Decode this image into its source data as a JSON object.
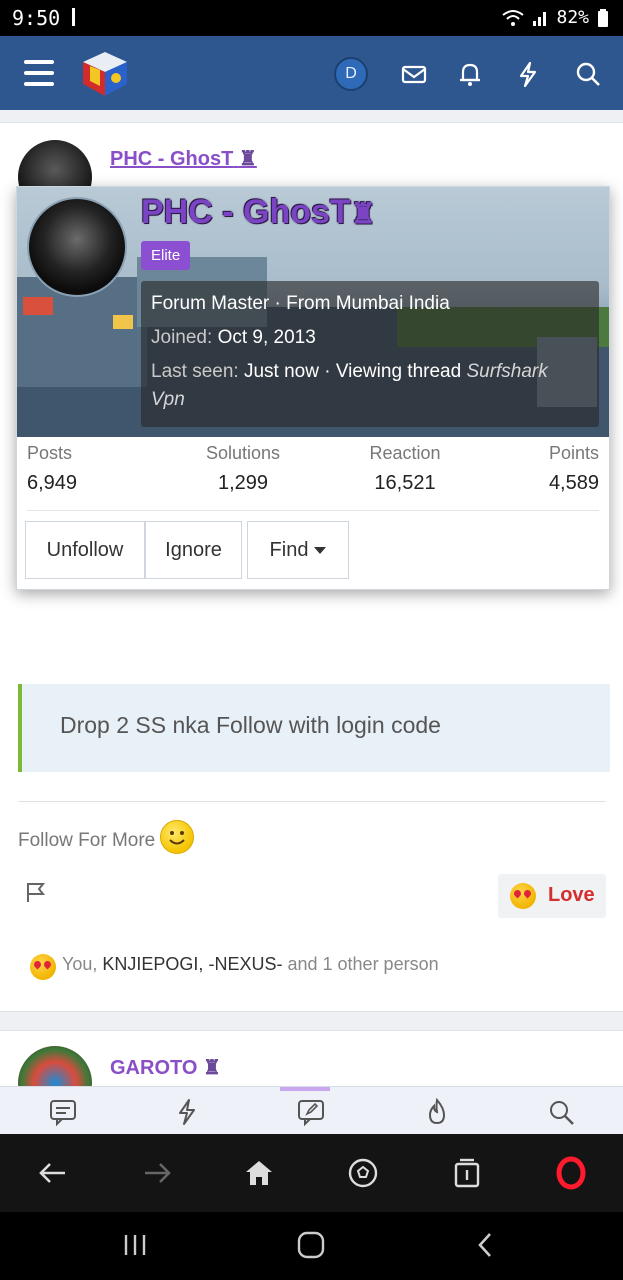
{
  "status_bar": {
    "time": "9:50",
    "battery": "82%"
  },
  "header": {
    "account_initial": "D"
  },
  "background_post": {
    "author": "PHC - GhosT"
  },
  "profile_popup": {
    "name": "PHC - GhosT",
    "badge": "Elite",
    "title_line": "Forum Master · From Mumbai India",
    "joined_label": "Joined:",
    "joined_value": "Oct 9, 2013",
    "last_seen_label": "Last seen:",
    "last_seen_value": "Just now · Viewing thread",
    "thread_title_part1": "Surfshark",
    "thread_title_part2": "Vpn",
    "stats": [
      {
        "label": "Posts",
        "value": "6,949"
      },
      {
        "label": "Solutions",
        "value": "1,299"
      },
      {
        "label": "Reaction",
        "value": "16,521"
      },
      {
        "label": "Points",
        "value": "4,589"
      }
    ],
    "buttons": {
      "unfollow": "Unfollow",
      "ignore": "Ignore",
      "find": "Find"
    }
  },
  "post": {
    "quote": "Drop 2 SS nka Follow with login code",
    "text": "Follow For More",
    "reaction_button": "Love",
    "reactions": {
      "you": "You,",
      "user1": "KNJIEPOGI,",
      "user2": "-NEXUS-",
      "others": "and 1 other person"
    }
  },
  "next_post": {
    "author": "GAROTO"
  },
  "colors": {
    "header": "#2e5790",
    "accent": "#8a4fc7",
    "badge": "#8d4fd2",
    "love": "#d32f2f",
    "quote_border": "#7bbb34"
  }
}
